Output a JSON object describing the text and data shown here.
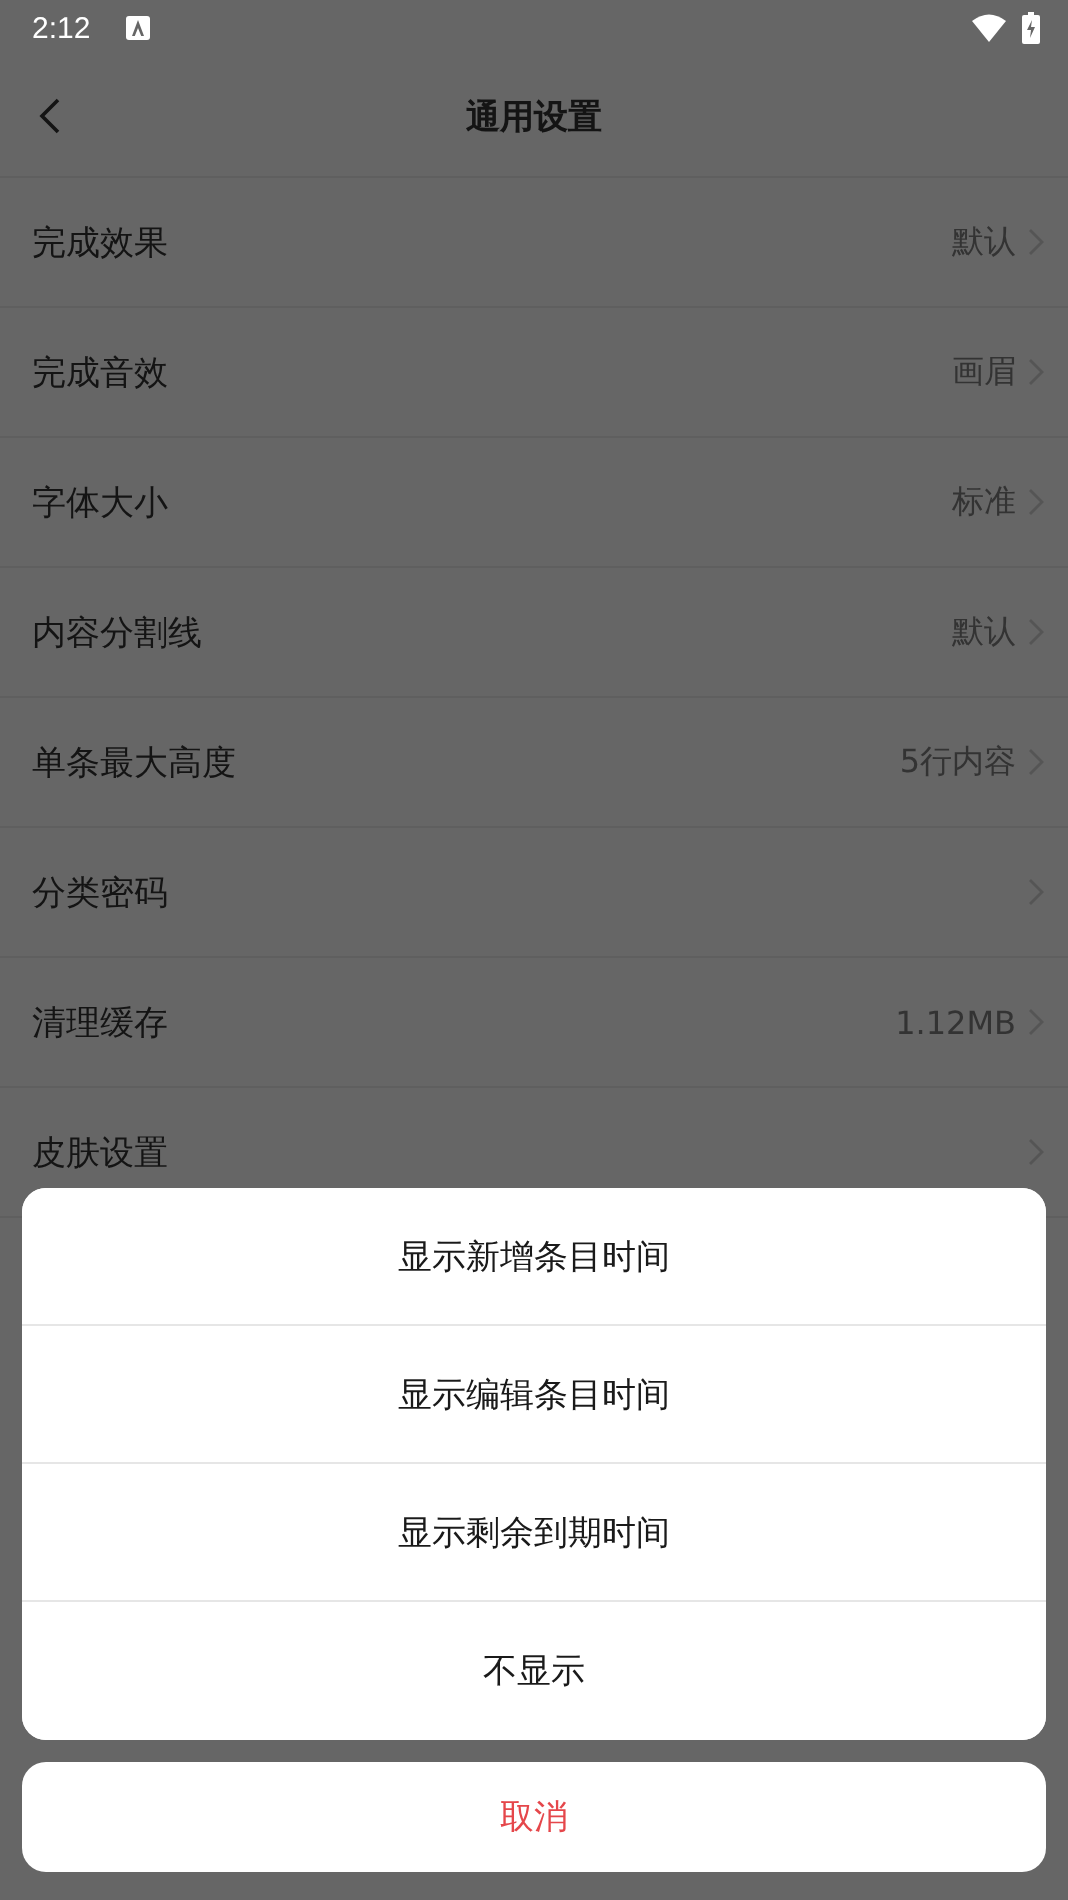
{
  "status_bar": {
    "time": "2:12"
  },
  "title_bar": {
    "title": "通用设置"
  },
  "settings": [
    {
      "label": "完成效果",
      "value": "默认"
    },
    {
      "label": "完成音效",
      "value": "画眉"
    },
    {
      "label": "字体大小",
      "value": "标准"
    },
    {
      "label": "内容分割线",
      "value": "默认"
    },
    {
      "label": "单条最大高度",
      "value": "5行内容"
    },
    {
      "label": "分类密码"
    },
    {
      "label": "清理缓存",
      "value": "1.12MB"
    },
    {
      "label": "皮肤设置"
    }
  ],
  "action_sheet": {
    "options": [
      "显示新增条目时间",
      "显示编辑条目时间",
      "显示剩余到期时间",
      "不显示"
    ],
    "cancel": "取消"
  }
}
